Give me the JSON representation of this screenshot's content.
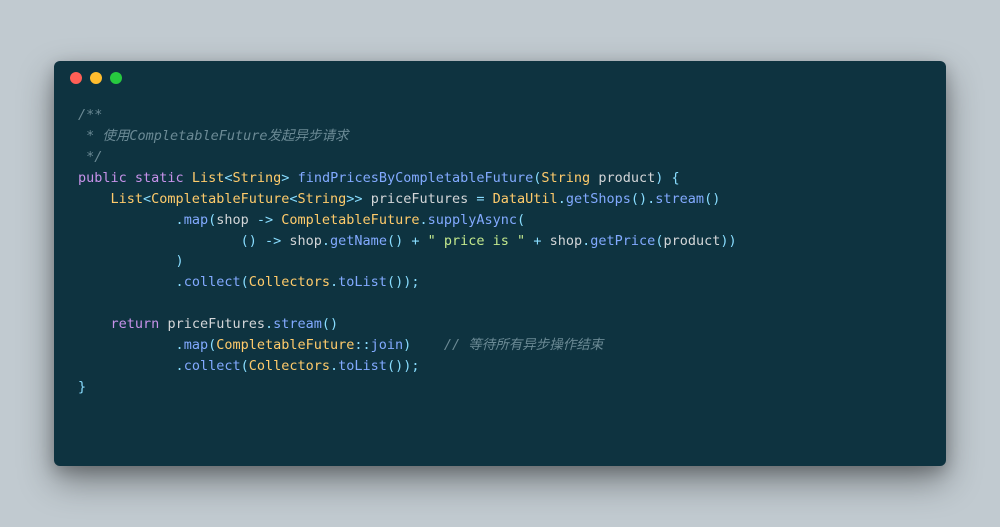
{
  "window": {
    "dots": [
      "red",
      "yellow",
      "green"
    ]
  },
  "code": {
    "comment_open": "/**",
    "comment_line": " * 使用CompletableFuture发起异步请求",
    "comment_close": " */",
    "kw_public": "public",
    "kw_static": "static",
    "kw_return": "return",
    "type_List": "List",
    "type_String": "String",
    "type_CompletableFuture": "CompletableFuture",
    "type_DataUtil": "DataUtil",
    "type_Collectors": "Collectors",
    "method_findPrices": "findPricesByCompletableFuture",
    "method_getShops": "getShops",
    "method_stream": "stream",
    "method_map": "map",
    "method_supplyAsync": "supplyAsync",
    "method_getName": "getName",
    "method_getPrice": "getPrice",
    "method_collect": "collect",
    "method_toList": "toList",
    "method_join": "join",
    "var_product": "product",
    "var_priceFutures": "priceFutures",
    "var_shop": "shop",
    "string_price_is": "\" price is \"",
    "inline_comment": "// 等待所有异步操作结束",
    "punc_lt": "<",
    "punc_gt": ">",
    "punc_lparen": "(",
    "punc_rparen": ")",
    "punc_lbrace": "{",
    "punc_rbrace": "}",
    "punc_dot": ".",
    "punc_comma": ",",
    "punc_semi": ";",
    "punc_colon2": "::",
    "op_arrow": "->",
    "op_assign": "=",
    "op_plus": "+"
  }
}
